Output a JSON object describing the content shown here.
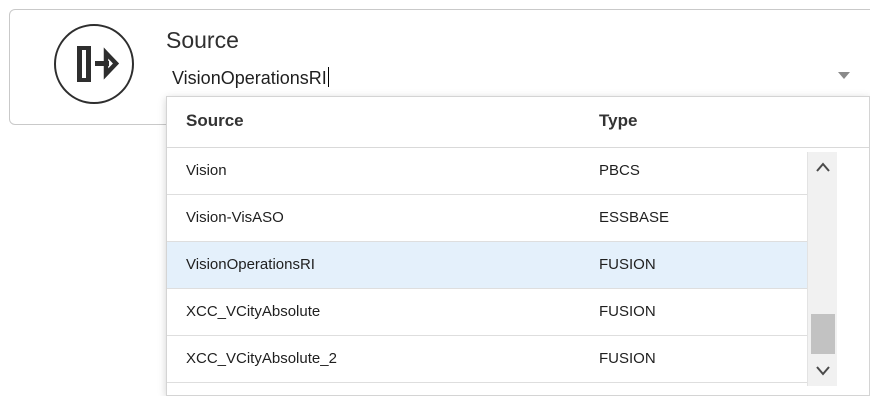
{
  "field": {
    "label": "Source",
    "value": "VisionOperationsRI",
    "icon": "source-connector-icon"
  },
  "dropdown": {
    "columns": {
      "source": "Source",
      "type": "Type"
    },
    "rows": [
      {
        "source": "Vision",
        "type": "PBCS",
        "selected": false
      },
      {
        "source": "Vision-VisASO",
        "type": "ESSBASE",
        "selected": false
      },
      {
        "source": "VisionOperationsRI",
        "type": "FUSION",
        "selected": true
      },
      {
        "source": "XCC_VCityAbsolute",
        "type": "FUSION",
        "selected": false
      },
      {
        "source": "XCC_VCityAbsolute_2",
        "type": "FUSION",
        "selected": false
      }
    ],
    "scroll_position": 0.75
  },
  "colors": {
    "selected_row": "#e4f0fb",
    "border": "#c9c9c9",
    "scroll_thumb": "#c2c2c2"
  }
}
